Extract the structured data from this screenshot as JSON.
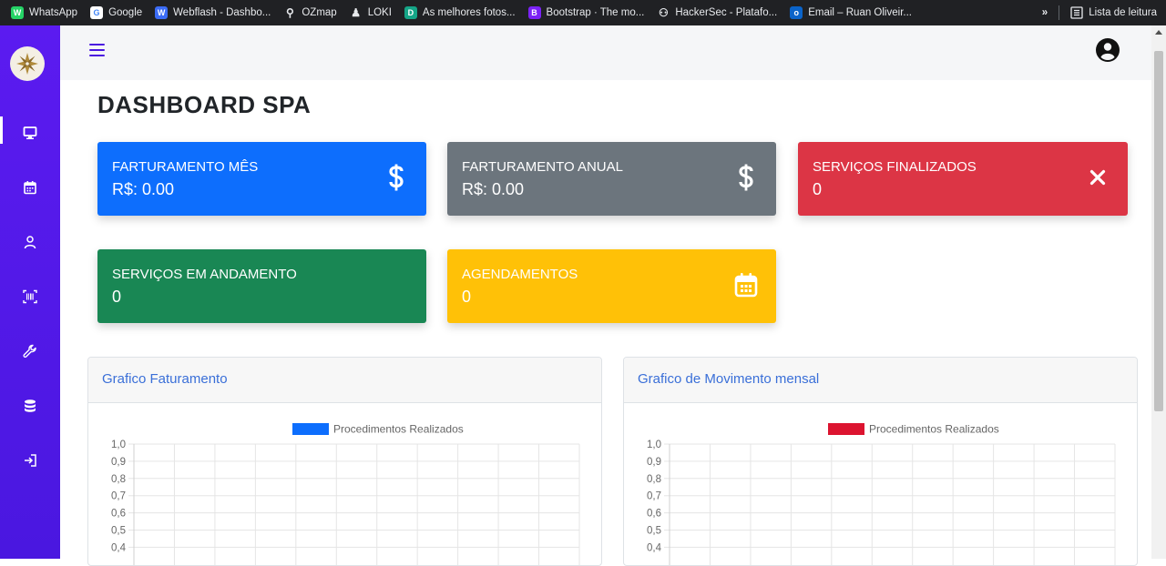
{
  "bookmarks": [
    {
      "label": "WhatsApp",
      "icon": "whatsapp-icon",
      "color": "#25d366",
      "glyph": "W"
    },
    {
      "label": "Google",
      "icon": "google-icon",
      "color": "#ffffff",
      "glyph": "G"
    },
    {
      "label": "Webflash - Dashbo...",
      "icon": "webflash-icon",
      "color": "#3b6cf6",
      "glyph": "W"
    },
    {
      "label": "OZmap",
      "icon": "map-pin-icon",
      "color": "#202124",
      "glyph": "⚲"
    },
    {
      "label": "LOKI",
      "icon": "loki-icon",
      "color": "#202124",
      "glyph": "♟"
    },
    {
      "label": "As melhores fotos...",
      "icon": "photos-icon",
      "color": "#15a587",
      "glyph": "D"
    },
    {
      "label": "Bootstrap · The mo...",
      "icon": "bootstrap-icon",
      "color": "#7b22f6",
      "glyph": "B"
    },
    {
      "label": "HackerSec - Platafo...",
      "icon": "hackersec-icon",
      "color": "#202124",
      "glyph": "⚇"
    },
    {
      "label": "Email – Ruan Oliveir...",
      "icon": "outlook-icon",
      "color": "#0a63c9",
      "glyph": "o"
    }
  ],
  "bookmarks_more": "»",
  "reading_list": "Lista de leitura",
  "sidebar": {
    "items": [
      {
        "name": "desktop-icon"
      },
      {
        "name": "calendar-icon"
      },
      {
        "name": "user-icon"
      },
      {
        "name": "barcode-icon"
      },
      {
        "name": "wrench-icon"
      },
      {
        "name": "database-icon"
      },
      {
        "name": "logout-icon"
      }
    ]
  },
  "page_title": "DASHBOARD SPA",
  "cards": {
    "fat_mes": {
      "label": "FARTURAMENTO MÊS",
      "value": "R$: 0.00",
      "color": "#0d6efd",
      "icon": "dollar-icon"
    },
    "fat_anual": {
      "label": "FARTURAMENTO ANUAL",
      "value": "R$: 0.00",
      "color": "#6c757d",
      "icon": "dollar-icon"
    },
    "finalizados": {
      "label": "SERVIÇOS FINALIZADOS",
      "value": "0",
      "color": "#dc3545",
      "icon": "close-icon"
    },
    "andamento": {
      "label": "SERVIÇOS EM ANDAMENTO",
      "value": "0",
      "color": "#198754"
    },
    "agendamentos": {
      "label": "AGENDAMENTOS",
      "value": "0",
      "color": "#ffc107",
      "icon": "calendar-icon"
    }
  },
  "charts": {
    "faturamento_title": "Grafico Faturamento",
    "movimento_title": "Grafico de Movimento mensal"
  },
  "chart_data": [
    {
      "type": "bar",
      "title": "",
      "series": [
        {
          "name": "Procedimentos Realizados",
          "values": [],
          "color": "#0d6efd"
        }
      ],
      "ylim": [
        0,
        1
      ],
      "yticks": [
        "1,0",
        "0,9",
        "0,8",
        "0,7",
        "0,6",
        "0,5",
        "0,4"
      ],
      "grid": true,
      "legend": "top-center"
    },
    {
      "type": "bar",
      "title": "",
      "series": [
        {
          "name": "Procedimentos Realizados",
          "values": [],
          "color": "#dc1430"
        }
      ],
      "ylim": [
        0,
        1
      ],
      "yticks": [
        "1,0",
        "0,9",
        "0,8",
        "0,7",
        "0,6",
        "0,5",
        "0,4"
      ],
      "grid": true,
      "legend": "top-center"
    }
  ]
}
